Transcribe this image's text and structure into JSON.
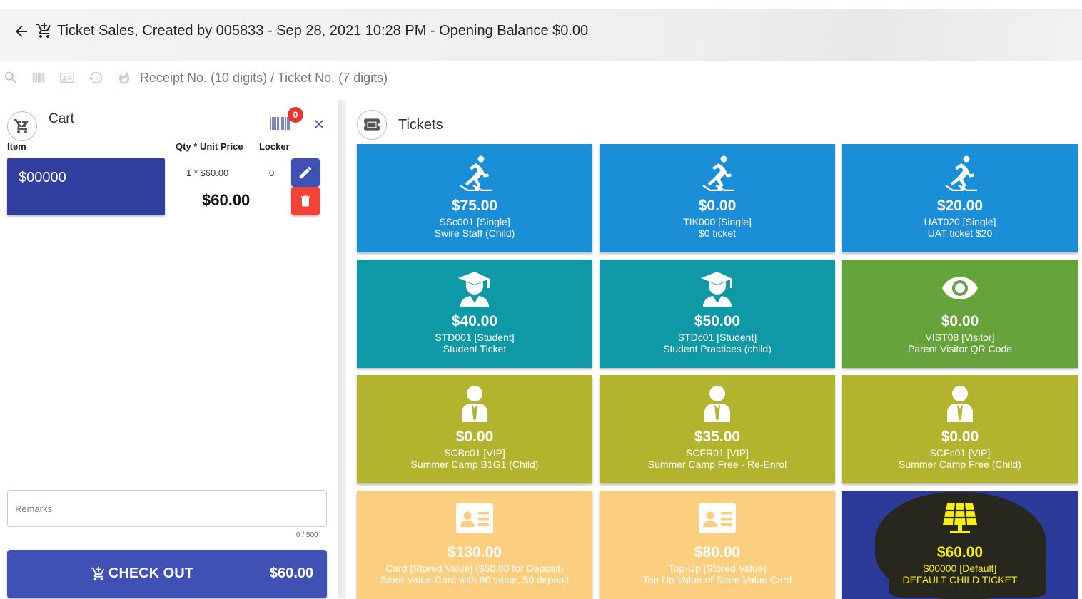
{
  "header": {
    "title": "Ticket Sales, Created by 005833 - Sep 28, 2021 10:28 PM - Opening Balance $0.00"
  },
  "search": {
    "placeholder": "Receipt No. (10 digits) / Ticket No. (7 digits)"
  },
  "cart": {
    "title": "Cart",
    "badge_count": "0",
    "columns": {
      "item": "Item",
      "qty_price": "Qty * Unit Price",
      "locker": "Locker"
    },
    "items": [
      {
        "name": "$00000",
        "qty_price": "1 * $60.00",
        "locker": "0",
        "total": "$60.00"
      }
    ],
    "remarks_placeholder": "Remarks",
    "remarks_counter": "0 / 500",
    "checkout_label": "CHECK OUT",
    "checkout_total": "$60.00"
  },
  "tickets": {
    "title": "Tickets",
    "items": [
      {
        "price": "$75.00",
        "code": "SSc001 [Single]",
        "name": "Swire Staff (Child)",
        "icon": "skating-icon",
        "color": "#1a8fd8"
      },
      {
        "price": "$0.00",
        "code": "TIK000 [Single]",
        "name": "$0 ticket",
        "icon": "skating-icon",
        "color": "#1a8fd8"
      },
      {
        "price": "$20.00",
        "code": "UAT020 [Single]",
        "name": "UAT ticket $20",
        "icon": "skating-icon",
        "color": "#1a8fd8"
      },
      {
        "price": "$40.00",
        "code": "STD001 [Student]",
        "name": "Student Ticket",
        "icon": "graduate-icon",
        "color": "#0f98a6"
      },
      {
        "price": "$50.00",
        "code": "STDc01 [Student]",
        "name": "Student Practices (child)",
        "icon": "graduate-icon",
        "color": "#0f98a6"
      },
      {
        "price": "$0.00",
        "code": "VIST08 [Visitor]",
        "name": "Parent Visitor QR Code",
        "icon": "eye-icon",
        "color": "#66a33a"
      },
      {
        "price": "$0.00",
        "code": "SCBc01 [VIP]",
        "name": "Summer Camp B1G1 (Child)",
        "icon": "vip-person-icon",
        "color": "#b1b42c"
      },
      {
        "price": "$35.00",
        "code": "SCFR01 [VIP]",
        "name": "Summer Camp Free - Re-Enrol",
        "icon": "vip-person-icon",
        "color": "#b1b42c"
      },
      {
        "price": "$0.00",
        "code": "SCFc01 [VIP]",
        "name": "Summer Camp Free (Child)",
        "icon": "vip-person-icon",
        "color": "#b1b42c"
      },
      {
        "price": "$130.00",
        "code": "Card [Stored Value] ($50.00 for Deposit)",
        "name": "Store Value Card with 80 value, 50 deposit",
        "icon": "id-card-icon",
        "color": "#fccf80"
      },
      {
        "price": "$80.00",
        "code": "Top-Up [Stored Value]",
        "name": "Top Up Value of Store Value Card",
        "icon": "id-card-icon",
        "color": "#fccf80"
      },
      {
        "price": "$60.00",
        "code": "$00000 [Default]",
        "name": "DEFAULT CHILD TICKET",
        "icon": "solar-panel-icon",
        "color": "#2c3a99"
      }
    ]
  }
}
